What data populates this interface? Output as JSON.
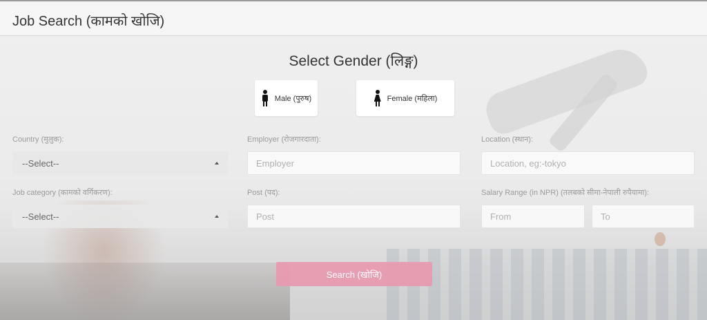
{
  "header": {
    "title": "Job Search (कामको खोजि)"
  },
  "gender": {
    "heading": "Select Gender (लिङ्ग)",
    "male_label": "Male (पुरुष)",
    "female_label": "Female (महिला)"
  },
  "fields": {
    "country": {
      "label": "Country (मुलुक):",
      "value": "--Select--"
    },
    "employer": {
      "label": "Employer (रोजगारदाता):",
      "placeholder": "Employer"
    },
    "location": {
      "label": "Location (स्थान):",
      "placeholder": "Location, eg:-tokyo"
    },
    "job_category": {
      "label": "Job category (कामको वर्गिकरण):",
      "value": "--Select--"
    },
    "post": {
      "label": "Post (पद):",
      "placeholder": "Post"
    },
    "salary": {
      "label": "Salary Range (in NPR) (तलबको सीमा-नेपाली रुपैयामा):",
      "from_placeholder": "From",
      "to_placeholder": "To"
    }
  },
  "search_button": {
    "label": "Search (खोजि)"
  },
  "colors": {
    "accent": "#e89bb0"
  }
}
